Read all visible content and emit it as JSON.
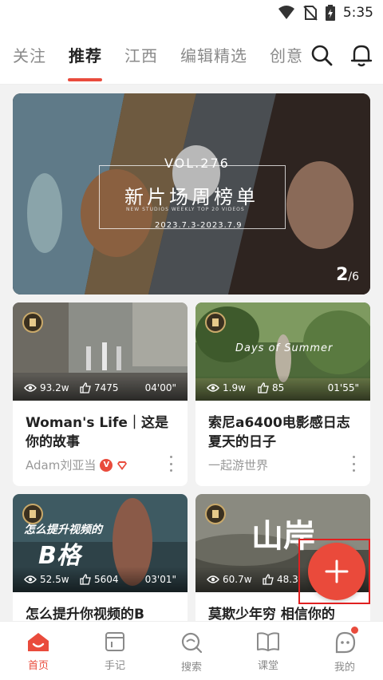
{
  "status_bar": {
    "time": "5:35"
  },
  "header": {
    "tabs": [
      {
        "label": "关注"
      },
      {
        "label": "推荐",
        "active": true
      },
      {
        "label": "江西"
      },
      {
        "label": "编辑精选"
      },
      {
        "label": "创意"
      }
    ],
    "icons": [
      "search-icon",
      "bell-icon"
    ]
  },
  "banner": {
    "vol": "VOL.276",
    "title": "新片场周榜单",
    "subtitle": "NEW STUDIOS WEEKLY TOP 20 VIDEOS",
    "date": "2023.7.3-2023.7.9",
    "page_current": "2",
    "page_total": "/6"
  },
  "cards": [
    {
      "title": "Woman's Life｜这是你的故事",
      "views": "93.2w",
      "likes": "7475",
      "duration": "04'00\"",
      "author": "Adam刘亚当",
      "verified": true
    },
    {
      "title": "索尼a6400电影感日志 夏天的日子",
      "views": "1.9w",
      "likes": "85",
      "duration": "01'55\"",
      "author": "一起游世界",
      "thumb_text": "Days of Summer"
    },
    {
      "title": "怎么提升你视频的B",
      "views": "52.5w",
      "likes": "5604",
      "duration": "03'01\"",
      "thumb_text_1": "怎么提升视频的",
      "thumb_text_2": "B格"
    },
    {
      "title": "莫欺少年穷 相信你的",
      "views": "60.7w",
      "likes": "48.3",
      "thumb_text": "山岸"
    }
  ],
  "bottom_nav": [
    {
      "label": "首页",
      "icon": "home-icon",
      "active": true
    },
    {
      "label": "手记",
      "icon": "notebook-icon"
    },
    {
      "label": "搜索",
      "icon": "search-icon"
    },
    {
      "label": "课堂",
      "icon": "book-icon"
    },
    {
      "label": "我的",
      "icon": "profile-icon",
      "has_dot": true
    }
  ],
  "colors": {
    "accent": "#e94b3c",
    "background": "#f2f2f2"
  }
}
